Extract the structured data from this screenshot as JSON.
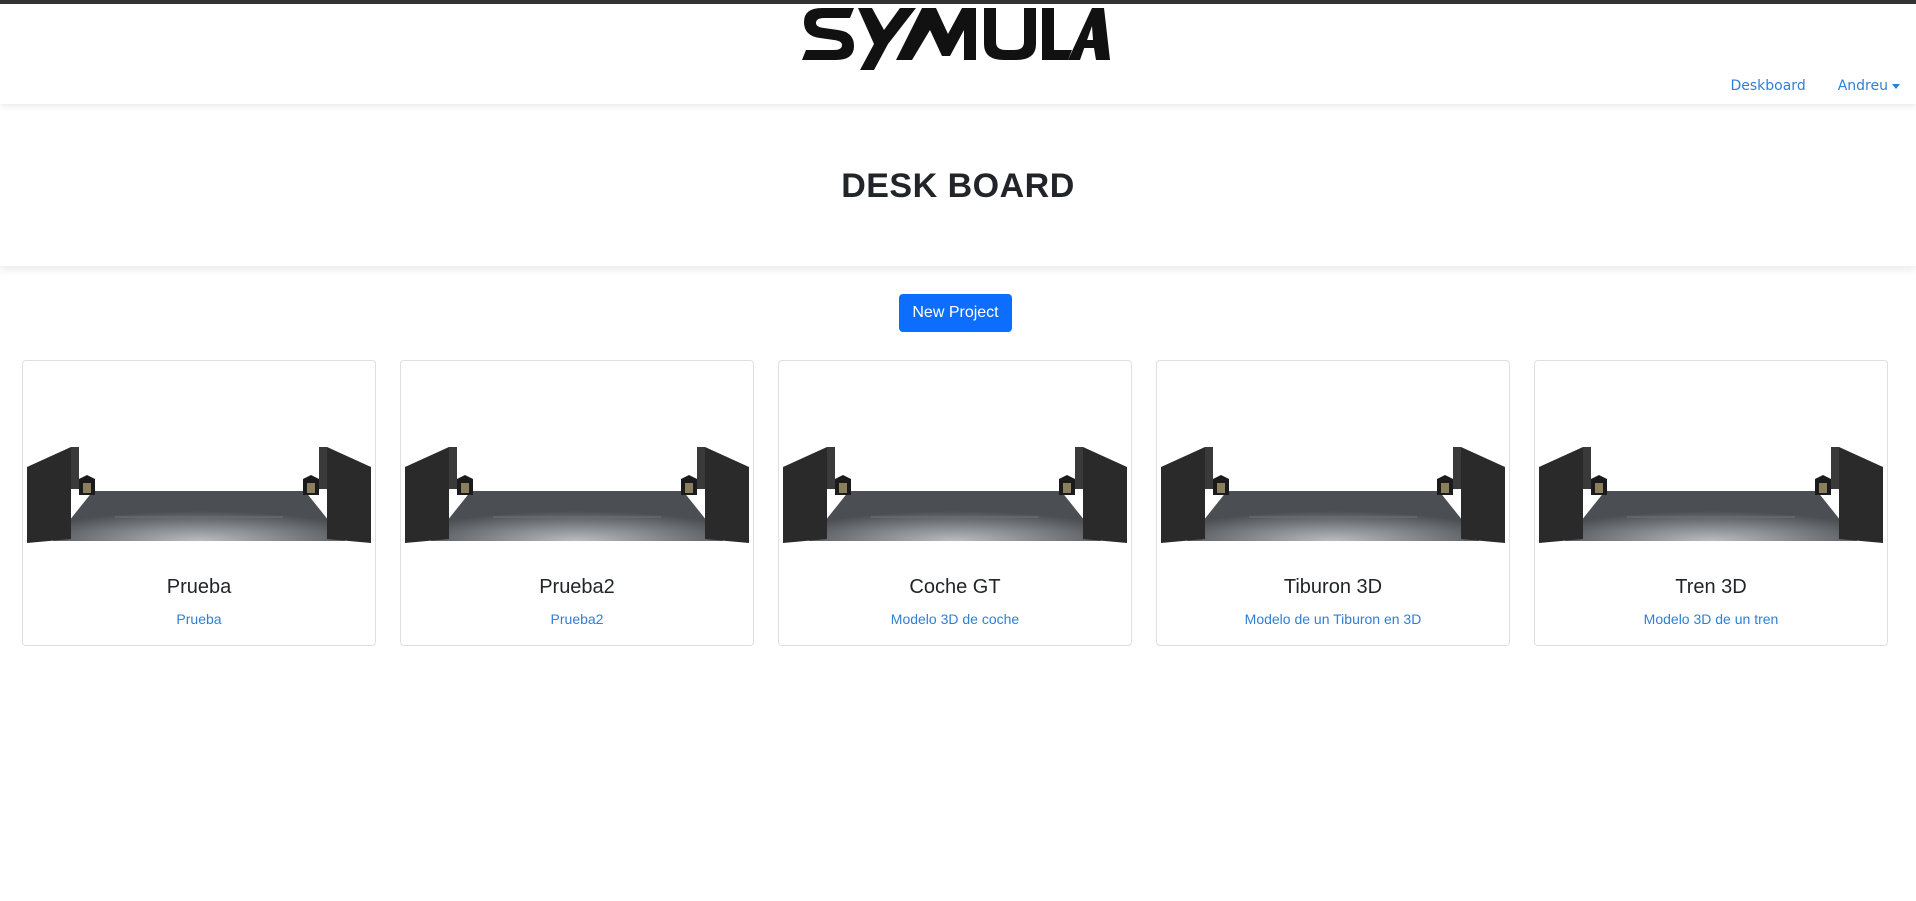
{
  "header": {
    "logo_text": "SYMULA",
    "nav": {
      "deskboard": "Deskboard",
      "user": "Andreu"
    }
  },
  "hero": {
    "title": "DESK BOARD"
  },
  "actions": {
    "new_project": "New Project"
  },
  "projects": [
    {
      "title": "Prueba",
      "description": "Prueba"
    },
    {
      "title": "Prueba2",
      "description": "Prueba2"
    },
    {
      "title": "Coche GT",
      "description": "Modelo 3D de coche"
    },
    {
      "title": "Tiburon 3D",
      "description": "Modelo de un Tiburon en 3D"
    },
    {
      "title": "Tren 3D",
      "description": "Modelo 3D de un tren"
    }
  ],
  "colors": {
    "accent": "#0d6efd",
    "link": "#2f7fd6",
    "topline": "#333333"
  }
}
